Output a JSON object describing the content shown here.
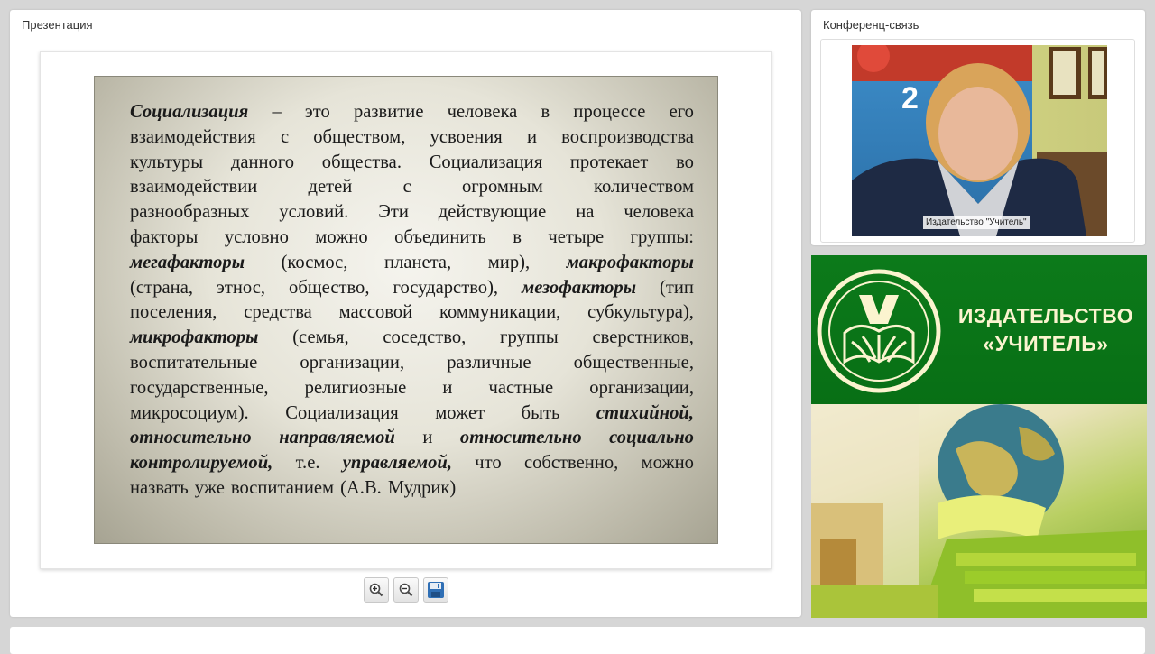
{
  "presentation": {
    "panel_title": "Презентация",
    "slide_lines": [
      [
        {
          "t": "Социализация",
          "bi": true
        },
        {
          "t": "–"
        },
        {
          "t": "это"
        },
        {
          "t": "развитие"
        },
        {
          "t": "человека"
        },
        {
          "t": "в"
        },
        {
          "t": "процессе"
        },
        {
          "t": "его"
        }
      ],
      [
        {
          "t": "взаимодействия"
        },
        {
          "t": "с"
        },
        {
          "t": "обществом,"
        },
        {
          "t": "усвоения"
        },
        {
          "t": "и"
        },
        {
          "t": "воспроизводства"
        }
      ],
      [
        {
          "t": "культуры"
        },
        {
          "t": "данного"
        },
        {
          "t": "общества."
        },
        {
          "t": "Социализация"
        },
        {
          "t": "протекает"
        },
        {
          "t": "во"
        }
      ],
      [
        {
          "t": "взаимодействии"
        },
        {
          "t": "детей"
        },
        {
          "t": "с"
        },
        {
          "t": "огромным"
        },
        {
          "t": "количеством"
        }
      ],
      [
        {
          "t": "разнообразных"
        },
        {
          "t": "условий."
        },
        {
          "t": "Эти"
        },
        {
          "t": "действующие"
        },
        {
          "t": "на"
        },
        {
          "t": "человека"
        }
      ],
      [
        {
          "t": "факторы"
        },
        {
          "t": "условно"
        },
        {
          "t": "можно"
        },
        {
          "t": "объединить"
        },
        {
          "t": "в"
        },
        {
          "t": "четыре"
        },
        {
          "t": "группы:"
        }
      ],
      [
        {
          "t": "мегафакторы",
          "bi": true
        },
        {
          "t": "(космос,"
        },
        {
          "t": "планета,"
        },
        {
          "t": "мир),"
        },
        {
          "t": "макрофакторы",
          "bi": true
        }
      ],
      [
        {
          "t": "(страна,"
        },
        {
          "t": "этнос,"
        },
        {
          "t": "общество,"
        },
        {
          "t": "государство),"
        },
        {
          "t": "мезофакторы",
          "bi": true
        },
        {
          "t": "(тип"
        }
      ],
      [
        {
          "t": "поселения,"
        },
        {
          "t": "средства"
        },
        {
          "t": "массовой"
        },
        {
          "t": "коммуникации,"
        },
        {
          "t": "субкультура),"
        }
      ],
      [
        {
          "t": "микрофакторы",
          "bi": true
        },
        {
          "t": "(семья,"
        },
        {
          "t": "соседство,"
        },
        {
          "t": "группы"
        },
        {
          "t": "сверстников,"
        }
      ],
      [
        {
          "t": "воспитательные"
        },
        {
          "t": "организации,"
        },
        {
          "t": "различные"
        },
        {
          "t": "общественные,"
        }
      ],
      [
        {
          "t": "государственные,"
        },
        {
          "t": "религиозные"
        },
        {
          "t": "и"
        },
        {
          "t": "частные"
        },
        {
          "t": "организации,"
        }
      ],
      [
        {
          "t": "микросоциум)."
        },
        {
          "t": "Социализация"
        },
        {
          "t": "может"
        },
        {
          "t": "быть"
        },
        {
          "t": "стихийной,",
          "bi": true
        }
      ],
      [
        {
          "t": "относительно",
          "bi": true
        },
        {
          "t": "направляемой",
          "bi": true
        },
        {
          "t": "и"
        },
        {
          "t": "относительно",
          "bi": true
        },
        {
          "t": "социально",
          "bi": true
        }
      ],
      [
        {
          "t": "контролируемой,",
          "bi": true
        },
        {
          "t": "т.е."
        },
        {
          "t": "управляемой,",
          "bi": true
        },
        {
          "t": "что"
        },
        {
          "t": "собственно,"
        },
        {
          "t": "можно"
        }
      ],
      [
        {
          "t": "назвать"
        },
        {
          "t": "уже"
        },
        {
          "t": "воспитанием"
        },
        {
          "t": "(А.В."
        },
        {
          "t": "Мудрик)"
        }
      ]
    ],
    "toolbar": [
      {
        "name": "zoom-in-button",
        "icon": "zoom-in-icon"
      },
      {
        "name": "zoom-out-button",
        "icon": "zoom-out-icon"
      },
      {
        "name": "save-button",
        "icon": "save-icon"
      }
    ]
  },
  "conference": {
    "panel_title": "Конференц-связь",
    "video_label": "Издательство \"Учитель\""
  },
  "ad": {
    "line1": "ИЗДАТЕЛЬСТВО",
    "line2": "«УЧИТЕЛЬ»",
    "brand_green": "#0b7618",
    "text_color": "#fbf4cf"
  }
}
